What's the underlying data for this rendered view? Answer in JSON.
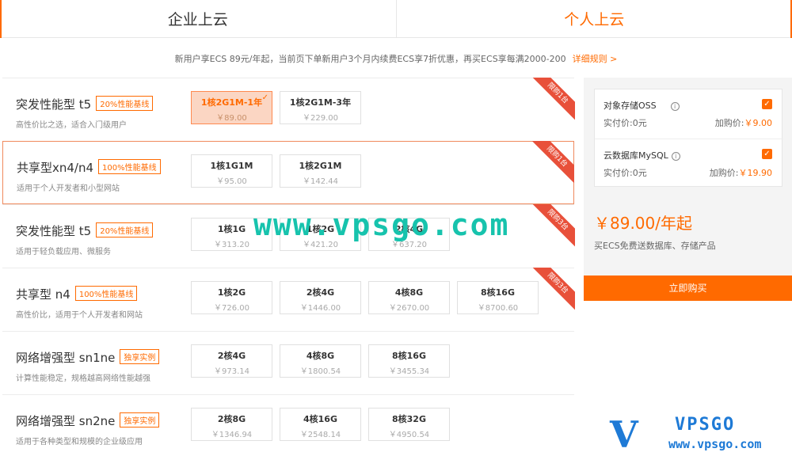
{
  "tabs": [
    {
      "label": "企业上云",
      "active": false
    },
    {
      "label": "个人上云",
      "active": true
    }
  ],
  "promo": {
    "text": "新用户享ECS 89元/年起，当前页下单新用户3个月内续费ECS享7折优惠，再买ECS享每满2000-200",
    "link": "详细规则 >"
  },
  "plans": [
    {
      "name": "突发性能型 t5",
      "badge": "20%性能基线",
      "desc": "高性价比之选，适合入门级用户",
      "ribbon": "限购1台",
      "options": [
        {
          "label": "1核2G1M-1年",
          "price": "￥89.00",
          "selected": true
        },
        {
          "label": "1核2G1M-3年",
          "price": "￥229.00",
          "selected": false
        }
      ]
    },
    {
      "name": "共享型xn4/n4",
      "badge": "100%性能基线",
      "desc": "适用于个人开发者和小型网站",
      "ribbon": "限购1台",
      "options": [
        {
          "label": "1核1G1M",
          "price": "￥95.00"
        },
        {
          "label": "1核2G1M",
          "price": "￥142.44"
        }
      ]
    },
    {
      "name": "突发性能型 t5",
      "badge": "20%性能基线",
      "desc": "适用于轻负载应用、微服务",
      "ribbon": "限购3台",
      "options": [
        {
          "label": "1核1G",
          "price": "￥313.20"
        },
        {
          "label": "1核2G",
          "price": "￥421.20"
        },
        {
          "label": "2核4G",
          "price": "￥637.20"
        }
      ]
    },
    {
      "name": "共享型 n4",
      "badge": "100%性能基线",
      "desc": "高性价比，适用于个人开发者和网站",
      "ribbon": "限购3台",
      "options": [
        {
          "label": "1核2G",
          "price": "￥726.00"
        },
        {
          "label": "2核4G",
          "price": "￥1446.00"
        },
        {
          "label": "4核8G",
          "price": "￥2670.00"
        },
        {
          "label": "8核16G",
          "price": "￥8700.60"
        }
      ]
    },
    {
      "name": "网络增强型 sn1ne",
      "badge": "独享实例",
      "desc": "计算性能稳定，规格越高网络性能越强",
      "options": [
        {
          "label": "2核4G",
          "price": "￥973.14"
        },
        {
          "label": "4核8G",
          "price": "￥1800.54"
        },
        {
          "label": "8核16G",
          "price": "￥3455.34"
        }
      ]
    },
    {
      "name": "网络增强型 sn2ne",
      "badge": "独享实例",
      "desc": "适用于各种类型和规模的企业级应用",
      "options": [
        {
          "label": "2核8G",
          "price": "￥1346.94"
        },
        {
          "label": "4核16G",
          "price": "￥2548.14"
        },
        {
          "label": "8核32G",
          "price": "￥4950.54"
        }
      ]
    }
  ],
  "addons": [
    {
      "name": "对象存储OSS",
      "real_label": "实付价:",
      "real_value": "0元",
      "buy_label": "加购价:",
      "buy_value": "￥9.00",
      "checked": true
    },
    {
      "name": "云数据库MySQL",
      "real_label": "实付价:",
      "real_value": "0元",
      "buy_label": "加购价:",
      "buy_value": "￥19.90",
      "checked": true
    }
  ],
  "summary": {
    "total": "￥89.00/年起",
    "sub": "买ECS免费送数据库、存储产品",
    "buy_button": "立即购买"
  },
  "watermark": "www.vpsgo.com",
  "logo": {
    "mark": "V",
    "big": "VPSGO",
    "small": "www.vpsgo.com"
  },
  "colors": {
    "accent": "#ff6a00",
    "ribbon": "#e8503a",
    "watermark": "#17c3ad",
    "logo": "#1e7ad6"
  }
}
